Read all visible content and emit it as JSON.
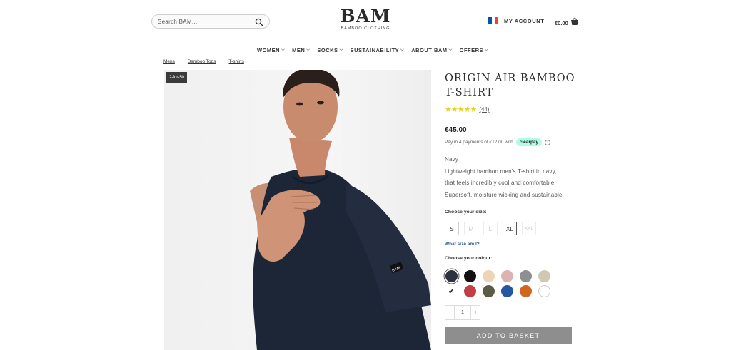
{
  "header": {
    "search_placeholder": "Search BAM...",
    "logo_main": "BAM",
    "logo_sub": "BAMBOO CLOTHING",
    "account_label": "MY ACCOUNT",
    "cart_amount": "€0.00",
    "flag_colors": [
      "#0055a4",
      "#ffffff",
      "#ef4135"
    ]
  },
  "nav": {
    "items": [
      {
        "label": "WOMEN"
      },
      {
        "label": "MEN"
      },
      {
        "label": "SOCKS"
      },
      {
        "label": "SUSTAINABILITY"
      },
      {
        "label": "ABOUT BAM"
      },
      {
        "label": "OFFERS"
      }
    ]
  },
  "breadcrumb": [
    "Mens",
    "Bamboo Tops",
    "T-shirts"
  ],
  "image": {
    "badge": "2-for-50",
    "tag_text": "BAM"
  },
  "product": {
    "title": "ORIGIN AIR BAMBOO T-SHIRT",
    "stars": "★★★★★",
    "reviews": "(44)",
    "price": "€45.00",
    "pay_text": "Pay in 4 payments of €12.00 with",
    "clearpay": "clearpay",
    "info_icon": "i",
    "description": [
      "Navy",
      "Lightweight bamboo men's T-shirt in navy,",
      "that feels incredibly cool and comfortable.",
      "Supersoft, moisture wicking and sustainable."
    ],
    "size_label": "Choose your size:",
    "sizes": [
      {
        "label": "S",
        "state": "available"
      },
      {
        "label": "M",
        "state": "out-of-stock"
      },
      {
        "label": "L",
        "state": "out-of-stock"
      },
      {
        "label": "XL",
        "state": "selected"
      },
      {
        "label": "XXL",
        "state": "out-of-stock"
      }
    ],
    "what_size": "What size am I?",
    "colour_label": "Choose your colour:",
    "colours_row1": [
      "#2c3340",
      "#111111",
      "#ecd5b4",
      "#ddb3b1",
      "#8e8f92",
      "#cfc9b3"
    ],
    "colours_row2": [
      "#c13e42",
      "#5b5c46",
      "#2458a1",
      "#d2661d",
      "#ffffff"
    ],
    "selected_colour": "#2c3340",
    "check_glyph": "✔",
    "qty_minus": "-",
    "qty_value": "1",
    "qty_plus": "+",
    "add_to_basket": "ADD TO BASKET"
  }
}
